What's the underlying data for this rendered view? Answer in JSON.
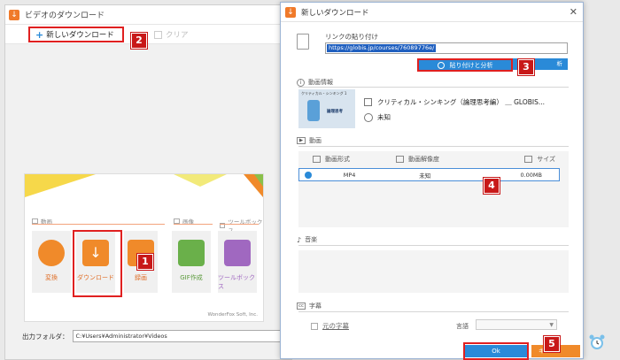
{
  "main_window": {
    "title": "ビデオのダウンロード",
    "new_download_label": "新しいダウンロード",
    "clear_label": "クリア",
    "categories": {
      "video": "動画",
      "image": "画像",
      "toolbox": "ツールボックス"
    },
    "tiles": [
      {
        "label": "変換",
        "color": "#f08a2a"
      },
      {
        "label": "ダウンロード",
        "color": "#f08a2a"
      },
      {
        "label": "録画",
        "color": "#f08a2a"
      },
      {
        "label": "GIF作成",
        "color": "#6ab04a"
      },
      {
        "label": "ツールボックス",
        "color": "#a068c0"
      }
    ],
    "brand": "WonderFox Soft, Inc.",
    "output_folder_label": "出力フォルダ：",
    "output_folder_path": "C:¥Users¥Administrator¥Videos"
  },
  "dialog": {
    "title": "新しいダウンロード",
    "paste_label": "リンクの貼り付け",
    "url": "https://globis.jp/courses/76089776e/",
    "analyze_label": "貼り付けと分析",
    "analyze_ghost_label": "析",
    "video_info_label": "動画情報",
    "thumb_caption": "クリティカル・シンキング 1",
    "thumb_text": "論理思考",
    "video_title": "クリティカル・シンキング（論理思考編） ＿ GLOBIS...",
    "video_duration": "未知",
    "video_section_label": "動画",
    "table_headers": {
      "format": "動画形式",
      "resolution": "動画解像度",
      "size": "サイズ"
    },
    "rows": [
      {
        "format": "MP4",
        "resolution": "未知",
        "size": "0.00MB"
      }
    ],
    "audio_label": "音楽",
    "subtitle_label": "字幕",
    "original_subtitle_label": "元の字幕",
    "language_label": "言語",
    "ok_label": "Ok",
    "cancel_label": "キ"
  },
  "badges": [
    "1",
    "2",
    "3",
    "4",
    "5"
  ],
  "colors": {
    "accent_blue": "#2a8ad8",
    "accent_orange": "#f08a2a",
    "highlight_red": "#e02020",
    "badge_red": "#c81818"
  }
}
